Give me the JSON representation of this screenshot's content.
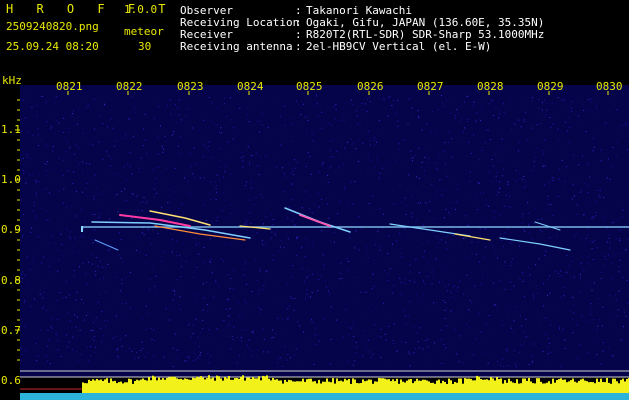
{
  "header": {
    "brand": "H R O F F T",
    "version": "1.0.0",
    "filename": "2509240820.png",
    "datetime": "25.09.24 08:20",
    "count_label": "meteor",
    "count_value": "30",
    "info": [
      {
        "label": "Observer",
        "value": "Takanori Kawachi"
      },
      {
        "label": "Receiving Location",
        "value": "Ogaki, Gifu, JAPAN (136.60E, 35.35N)"
      },
      {
        "label": "Receiver",
        "value": "R820T2(RTL-SDR) SDR-Sharp 53.1000MHz"
      },
      {
        "label": "Receiving antenna",
        "value": "2el-HB9CV Vertical (el. E-W)"
      }
    ]
  },
  "axes": {
    "y_unit": "kHz",
    "x_ticks": [
      "0821",
      "0822",
      "0823",
      "0824",
      "0825",
      "0826",
      "0827",
      "0828",
      "0829",
      "0830"
    ],
    "y_ticks": [
      "1.1",
      "1.0",
      "0.9",
      "0.8",
      "0.7",
      "0.6"
    ]
  },
  "colors": {
    "background": "#000000",
    "spectrum_bg": "#05034a",
    "text_header": "#e8e800",
    "text_info": "#ffffff",
    "signal_line": "#8fd7ff",
    "meteor_hot": "#ff3aa0",
    "level_bar": "#f2f21a",
    "baseline": "#32d2ff"
  },
  "icons": []
}
